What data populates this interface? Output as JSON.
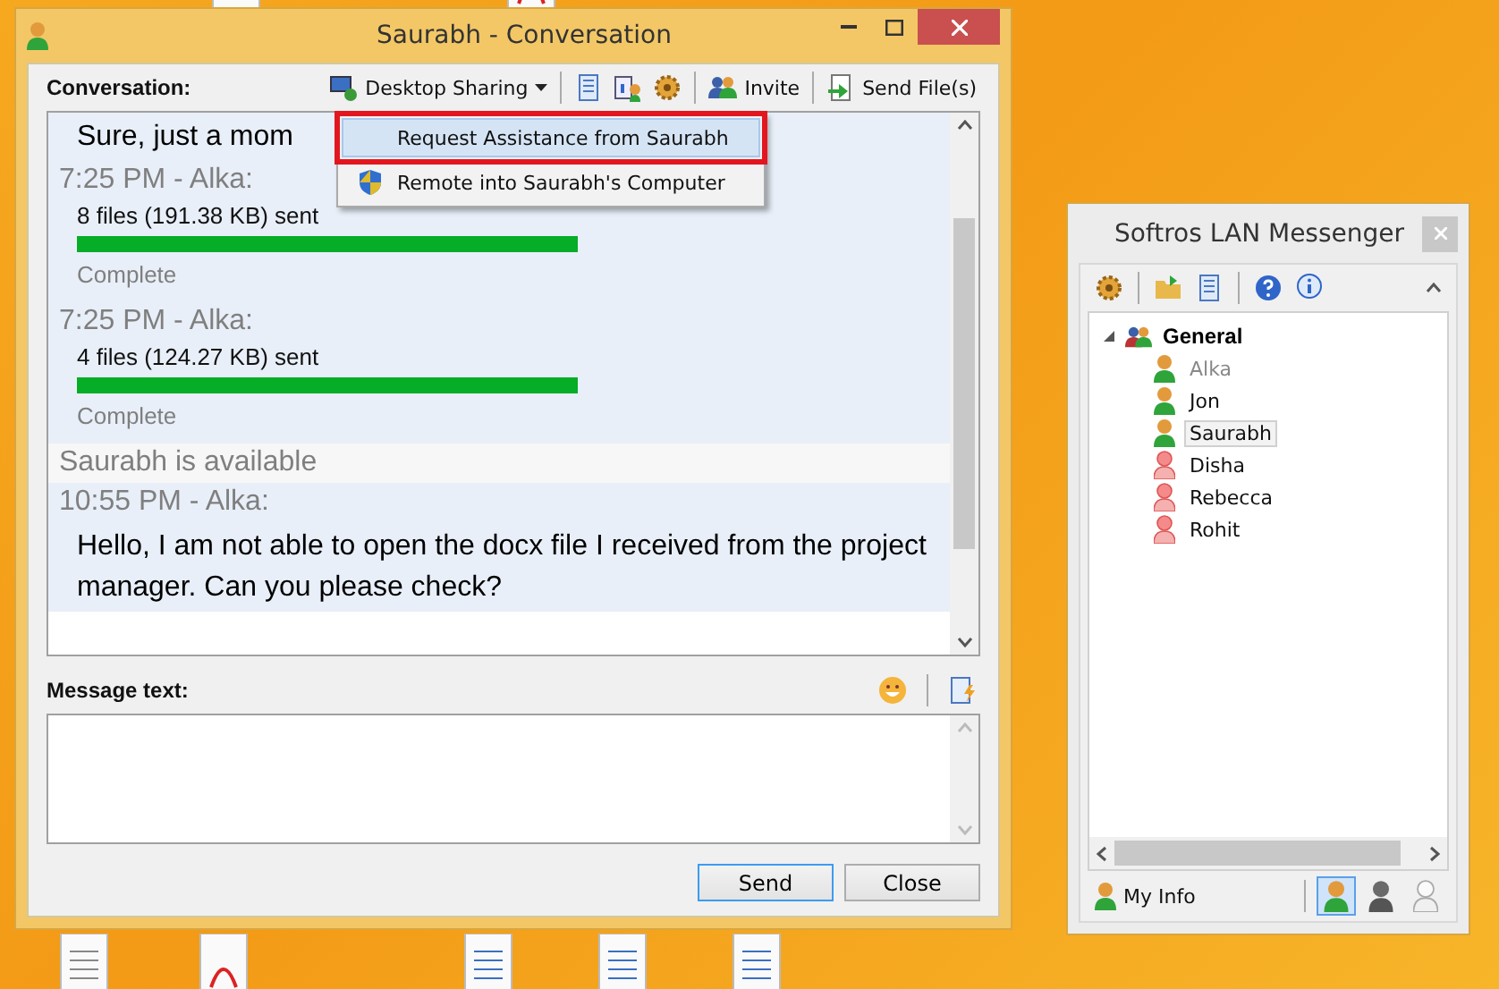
{
  "conversation_window": {
    "title": "Saurabh - Conversation",
    "conversation_label": "Conversation:",
    "toolbar": [
      {
        "kind": "dropdown",
        "label": "Desktop Sharing"
      },
      {
        "kind": "separator"
      },
      {
        "kind": "icon"
      },
      {
        "kind": "icon"
      },
      {
        "kind": "icon"
      },
      {
        "kind": "separator"
      },
      {
        "kind": "button",
        "label": "Invite"
      },
      {
        "kind": "separator"
      },
      {
        "kind": "button",
        "label": "Send File(s)"
      }
    ],
    "menu": [
      {
        "label": "Request Assistance from Saurabh",
        "selected": true,
        "highlighted": true
      },
      {
        "label": "Remote into Saurabh's Computer",
        "selected": false,
        "highlighted": false
      }
    ],
    "chat": [
      {
        "kind": "message",
        "text": "Sure, just a mom"
      },
      {
        "kind": "header",
        "text": "7:25 PM - Alka:"
      },
      {
        "kind": "transfer",
        "text": "8 files (191.38 KB) sent",
        "level": 1,
        "status": "Complete"
      },
      {
        "kind": "header",
        "text": "7:25 PM - Alka:"
      },
      {
        "kind": "transfer",
        "text": "4 files (124.27 KB) sent",
        "level": 1,
        "status": "Complete"
      },
      {
        "kind": "notice",
        "text": "Saurabh is available"
      },
      {
        "kind": "header",
        "text": "10:55 PM - Alka:"
      },
      {
        "kind": "message",
        "text": "Hello, I am not able to open the docx file I received from the project manager. Can you please check?"
      }
    ],
    "message_label": "Message text:",
    "buttons": [
      {
        "label": "Send",
        "default": true
      },
      {
        "label": "Close",
        "default": false
      }
    ]
  },
  "messenger_window": {
    "title": "Softros LAN Messenger",
    "groups": [
      {
        "label": "General",
        "expanded": true,
        "children": [
          {
            "name": "Alka",
            "kind": "online",
            "disabled": true,
            "selected": false
          },
          {
            "name": "Jon",
            "kind": "online",
            "disabled": false,
            "selected": false
          },
          {
            "name": "Saurabh",
            "kind": "online",
            "disabled": false,
            "selected": true
          },
          {
            "name": "Disha",
            "kind": "offline",
            "disabled": false,
            "selected": false
          },
          {
            "name": "Rebecca",
            "kind": "offline",
            "disabled": false,
            "selected": false
          },
          {
            "name": "Rohit",
            "kind": "offline",
            "disabled": false,
            "selected": false
          }
        ]
      }
    ],
    "my_info": "My Info",
    "status_buttons": [
      {
        "kind": "online",
        "selected": true
      },
      {
        "kind": "away",
        "selected": false
      },
      {
        "kind": "offline",
        "selected": false
      }
    ]
  }
}
